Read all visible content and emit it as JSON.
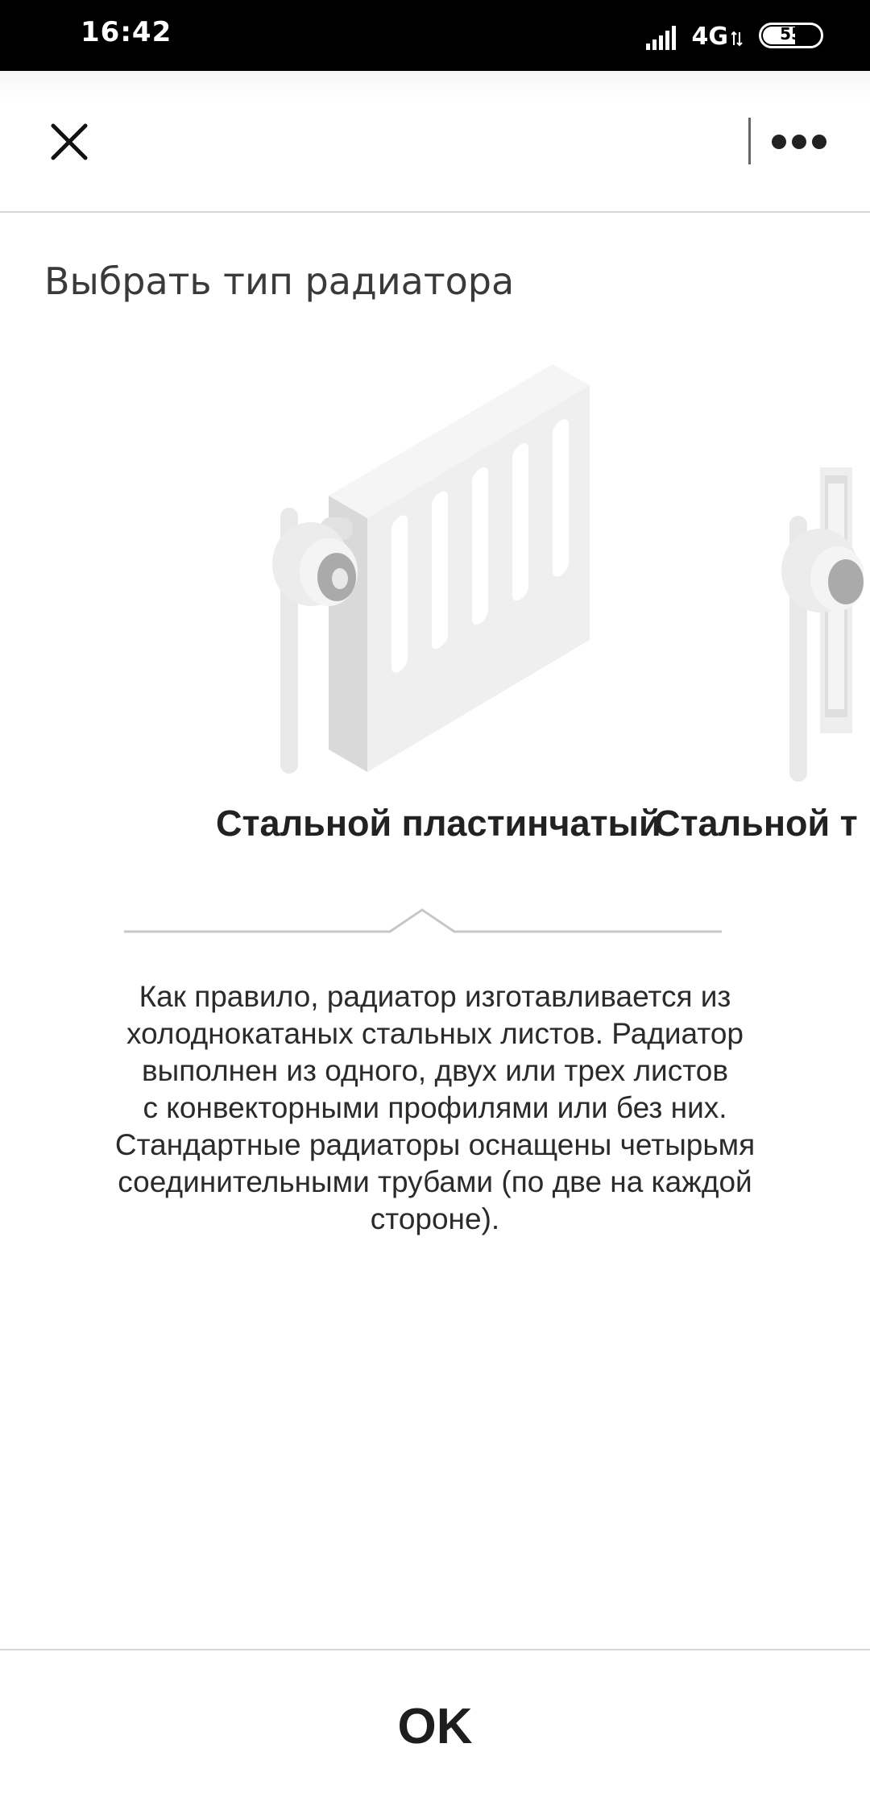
{
  "status_bar": {
    "time": "16:42",
    "network": "4G",
    "battery": "55",
    "icons": [
      "signal-icon",
      "network-arrows-icon",
      "battery-icon"
    ]
  },
  "toolbar": {
    "close_icon": "close-icon",
    "more_icon": "more-dots-icon"
  },
  "page": {
    "title": "Выбрать тип радиатора"
  },
  "carousel": {
    "items": [
      {
        "label": "Стальной пластинчатый",
        "icon": "panel-radiator-icon",
        "selected": true
      },
      {
        "label": "Стальной т",
        "icon": "tubular-radiator-icon",
        "selected": false
      }
    ]
  },
  "description": {
    "lines": [
      "Как правило, радиатор изготавливается из",
      "холоднокатаных стальных листов. Радиатор",
      "выполнен из одного, двух или трех листов",
      "с конвекторными профилями или без них.",
      "Стандартные радиаторы оснащены четырьмя",
      "соединительными трубами (по две на каждой",
      "стороне)."
    ]
  },
  "footer": {
    "ok_label": "OK"
  },
  "colors": {
    "status_bar": "#000000",
    "text": "#1e1e1e",
    "illustration_light": "#eeeeee",
    "illustration_mid": "#dcdcdc",
    "illustration_dark": "#a8a8a8",
    "divider": "#d6d6d6"
  }
}
